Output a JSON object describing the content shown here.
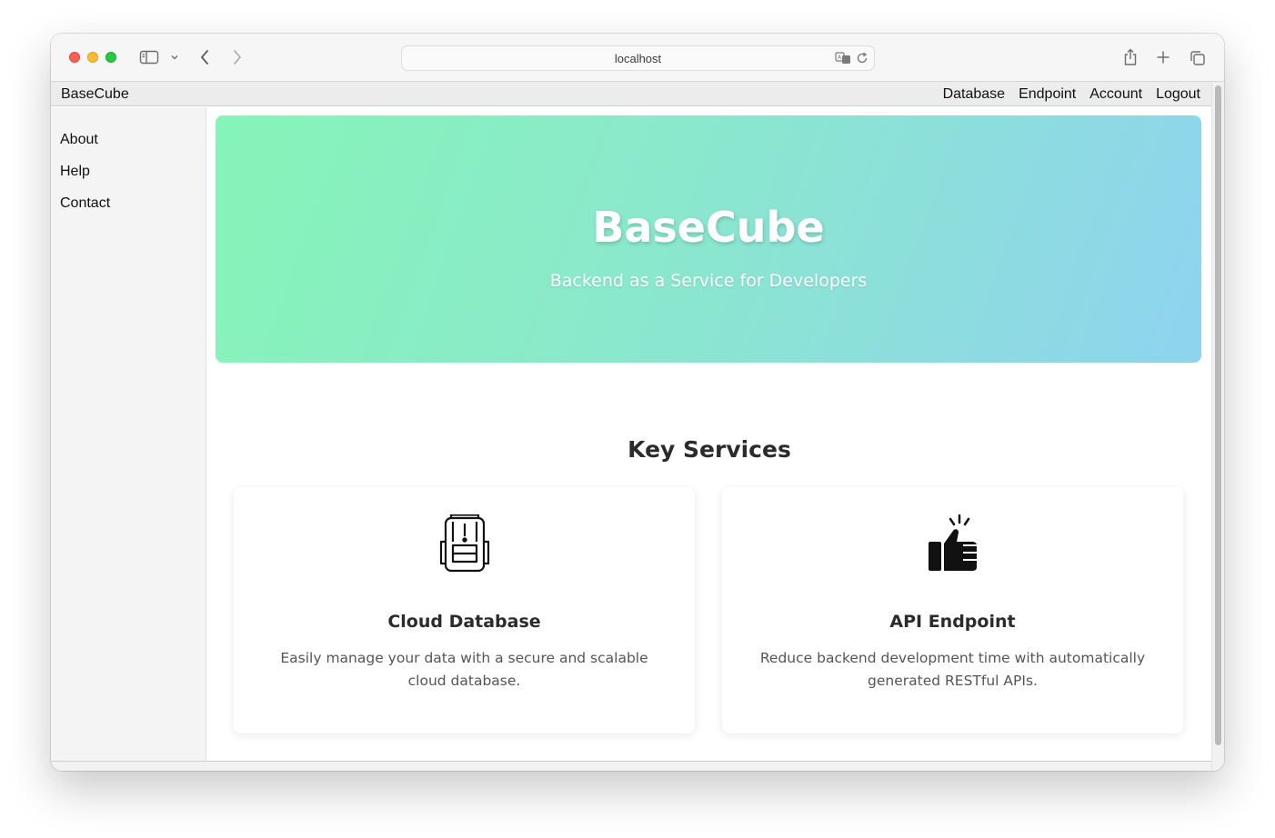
{
  "browser": {
    "url": "localhost",
    "controls": {
      "sidebar_toggle": "sidebar-icon",
      "back": "chevron-left-icon",
      "forward": "chevron-right-icon",
      "translate": "translate-icon",
      "reload": "reload-icon",
      "share": "share-icon",
      "new_tab": "plus-icon",
      "tabs": "tabs-icon"
    }
  },
  "navbar": {
    "brand": "BaseCube",
    "links": [
      "Database",
      "Endpoint",
      "Account",
      "Logout"
    ]
  },
  "sidebar": {
    "items": [
      "About",
      "Help",
      "Contact"
    ]
  },
  "hero": {
    "title": "BaseCube",
    "subtitle": "Backend as a Service for Developers",
    "gradient": [
      "#86f5b8",
      "#8fd3ef"
    ]
  },
  "services": {
    "heading": "Key Services",
    "cards": [
      {
        "icon": "backpack-icon",
        "title": "Cloud Database",
        "description": "Easily manage your data with a secure and scalable cloud database."
      },
      {
        "icon": "thumbs-up-icon",
        "title": "API Endpoint",
        "description": "Reduce backend development time with automatically generated RESTful APIs."
      }
    ]
  }
}
